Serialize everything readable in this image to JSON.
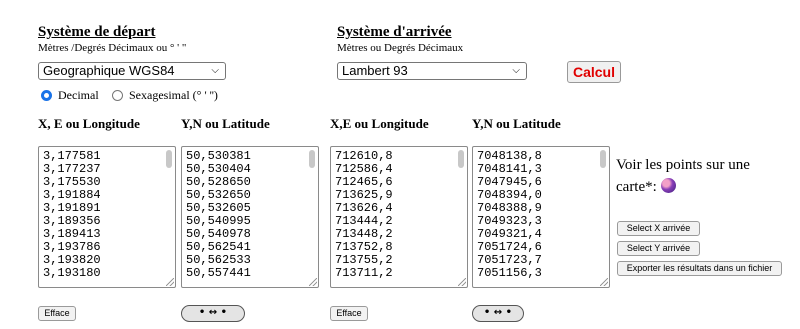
{
  "source": {
    "title": "Système de départ",
    "subtitle": "Mètres /Degrés Décimaux ou ° ' \"",
    "system_selected": "Geographique WGS84",
    "format_options": [
      {
        "label": "Decimal",
        "selected": true
      },
      {
        "label": "Sexagesimal (° ' '')",
        "selected": false
      }
    ],
    "col1_header": "X, E ou Longitude",
    "col2_header": "Y,N ou Latitude",
    "col1_values": [
      "3,177581",
      "3,177237",
      "3,175530",
      "3,191884",
      "3,191891",
      "3,189356",
      "3,189413",
      "3,193786",
      "3,193820",
      "3,193180"
    ],
    "col2_values": [
      "50,530381",
      "50,530404",
      "50,528650",
      "50,532650",
      "50,532605",
      "50,540995",
      "50,540978",
      "50,562541",
      "50,562533",
      "50,557441"
    ],
    "clear_label": "Efface",
    "swap_label": "↔"
  },
  "target": {
    "title": "Système d'arrivée",
    "subtitle": "Mètres ou Degrés Décimaux",
    "system_selected": "Lambert 93",
    "calc_label": "Calcul",
    "col1_header": "X,E ou Longitude",
    "col2_header": "Y,N ou Latitude",
    "col1_values": [
      "712610,8",
      "712586,4",
      "712465,6",
      "713625,9",
      "713626,4",
      "713444,2",
      "713448,2",
      "713752,8",
      "713755,2",
      "713711,2"
    ],
    "col2_values": [
      "7048138,8",
      "7048141,3",
      "7047945,6",
      "7048394,0",
      "7048388,9",
      "7049323,3",
      "7049321,4",
      "7051724,6",
      "7051723,7",
      "7051156,3"
    ],
    "clear_label": "Efface",
    "swap_label": "↔"
  },
  "side": {
    "map_text_line1": "Voir les points sur une",
    "map_text_line2": "carte*:",
    "map_icon": "globe-icon",
    "select_x_label": "Select X arrivée",
    "select_y_label": "Select Y arrivée",
    "export_label": "Exporter les résultats dans un fichier"
  },
  "colors": {
    "calc_text": "#e00000",
    "radio_accent": "#1a73e8"
  }
}
